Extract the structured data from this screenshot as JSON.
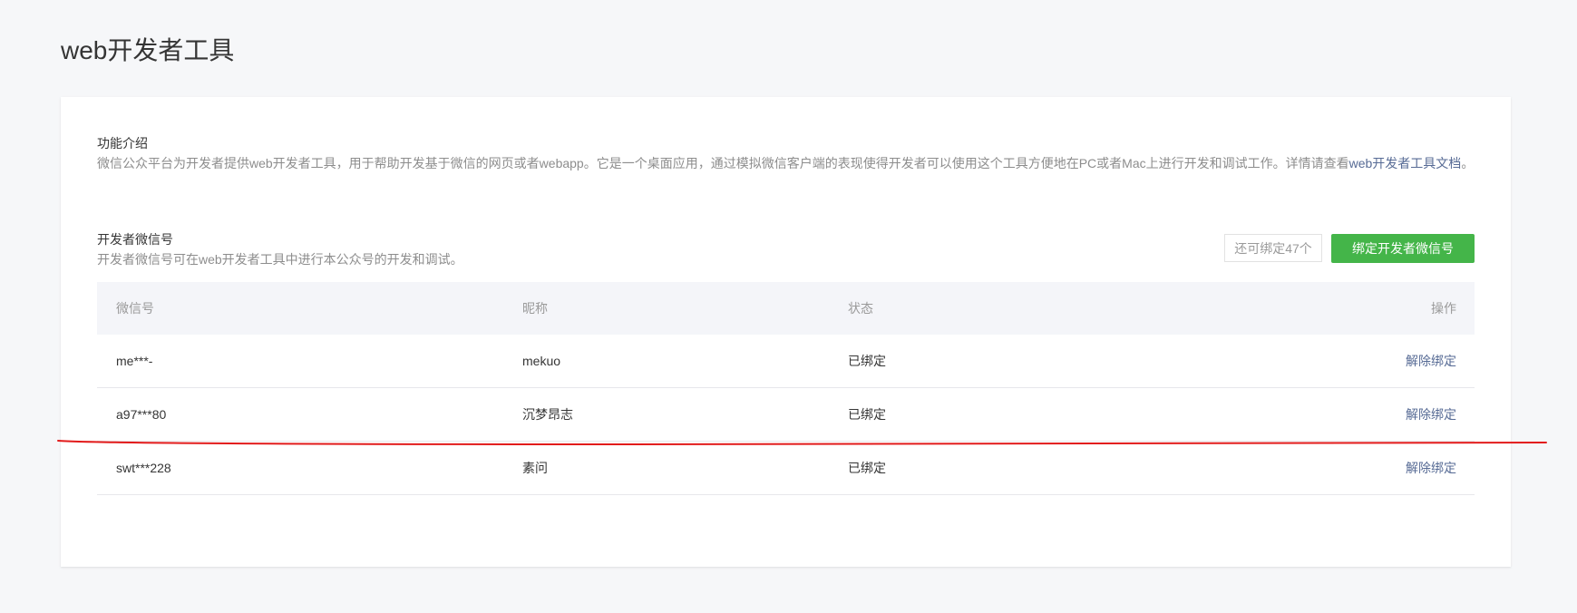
{
  "page": {
    "title": "web开发者工具"
  },
  "intro": {
    "heading": "功能介绍",
    "description": "微信公众平台为开发者提供web开发者工具，用于帮助开发基于微信的网页或者webapp。它是一个桌面应用，通过模拟微信客户端的表现使得开发者可以使用这个工具方便地在PC或者Mac上进行开发和调试工作。详情请查看",
    "doc_link": "web开发者工具文档",
    "description_end": "。"
  },
  "developers": {
    "heading": "开发者微信号",
    "description": "开发者微信号可在web开发者工具中进行本公众号的开发和调试。",
    "remaining_label": "还可绑定47个",
    "bind_button_label": "绑定开发者微信号"
  },
  "table": {
    "headers": [
      "微信号",
      "昵称",
      "状态",
      "操作"
    ],
    "rows": [
      {
        "wechat_id": "me***-",
        "nickname": "mekuo",
        "status": "已绑定",
        "action": "解除绑定"
      },
      {
        "wechat_id": "a97***80",
        "nickname": "沉梦昂志",
        "status": "已绑定",
        "action": "解除绑定"
      },
      {
        "wechat_id": "swt***228",
        "nickname": "素问",
        "status": "已绑定",
        "action": "解除绑定"
      }
    ]
  },
  "colors": {
    "background": "#f6f7f9",
    "primary_green": "#44b549",
    "link_blue": "#576b95",
    "annotation_red": "#e21b1b"
  }
}
